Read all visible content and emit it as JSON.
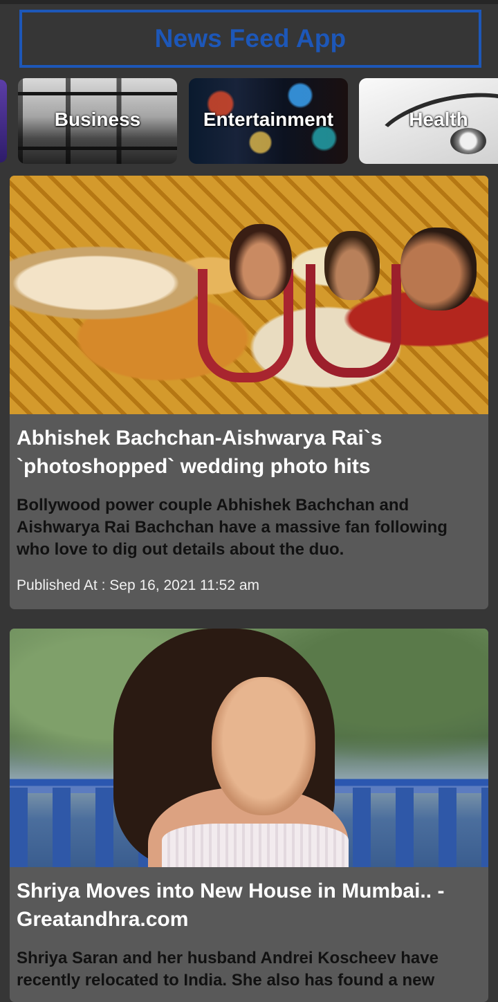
{
  "app": {
    "title": "News Feed App"
  },
  "categories": [
    {
      "label": "Business",
      "image_icon": "office-building-image"
    },
    {
      "label": "Entertainment",
      "image_icon": "city-lights-image"
    },
    {
      "label": "Health",
      "image_icon": "stethoscope-image"
    }
  ],
  "articles": [
    {
      "title": "Abhishek Bachchan-Aishwarya Rai`s `photoshopped` wedding photo hits",
      "description": "Bollywood power couple Abhishek Bachchan and Aishwarya Rai Bachchan have a massive fan following who love to dig out details about the duo.",
      "published": "Published At : Sep 16, 2021 11:52 am",
      "image_icon": "wedding-photo-image"
    },
    {
      "title": "Shriya Moves into New House in Mumbai.. - Greatandhra.com",
      "description": "Shriya Saran and her husband Andrei Koscheev have recently relocated to India. She also has found a new",
      "image_icon": "portrait-photo-image"
    }
  ],
  "colors": {
    "background": "#363636",
    "accent": "#1d57b8",
    "card": "#595959"
  }
}
